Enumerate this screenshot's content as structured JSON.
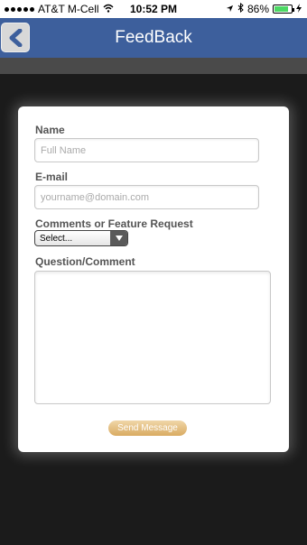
{
  "status_bar": {
    "carrier": "AT&T M-Cell",
    "time": "10:52 PM",
    "battery_percent": "86%",
    "battery_level": 0.86,
    "icons": [
      "signal-dots-icon",
      "wifi-icon",
      "location-icon",
      "bluetooth-icon",
      "battery-icon",
      "charging-icon"
    ]
  },
  "nav": {
    "title": "FeedBack",
    "back_icon": "back-arrow-icon",
    "color": "#3d5f9c"
  },
  "form": {
    "name": {
      "label": "Name",
      "placeholder": "Full Name",
      "value": ""
    },
    "email": {
      "label": "E-mail",
      "placeholder": "yourname@domain.com",
      "value": ""
    },
    "comments": {
      "label": "Comments or Feature Request",
      "selected": "Select..."
    },
    "question": {
      "label": "Question/Comment",
      "value": ""
    },
    "send_label": "Send Message"
  }
}
